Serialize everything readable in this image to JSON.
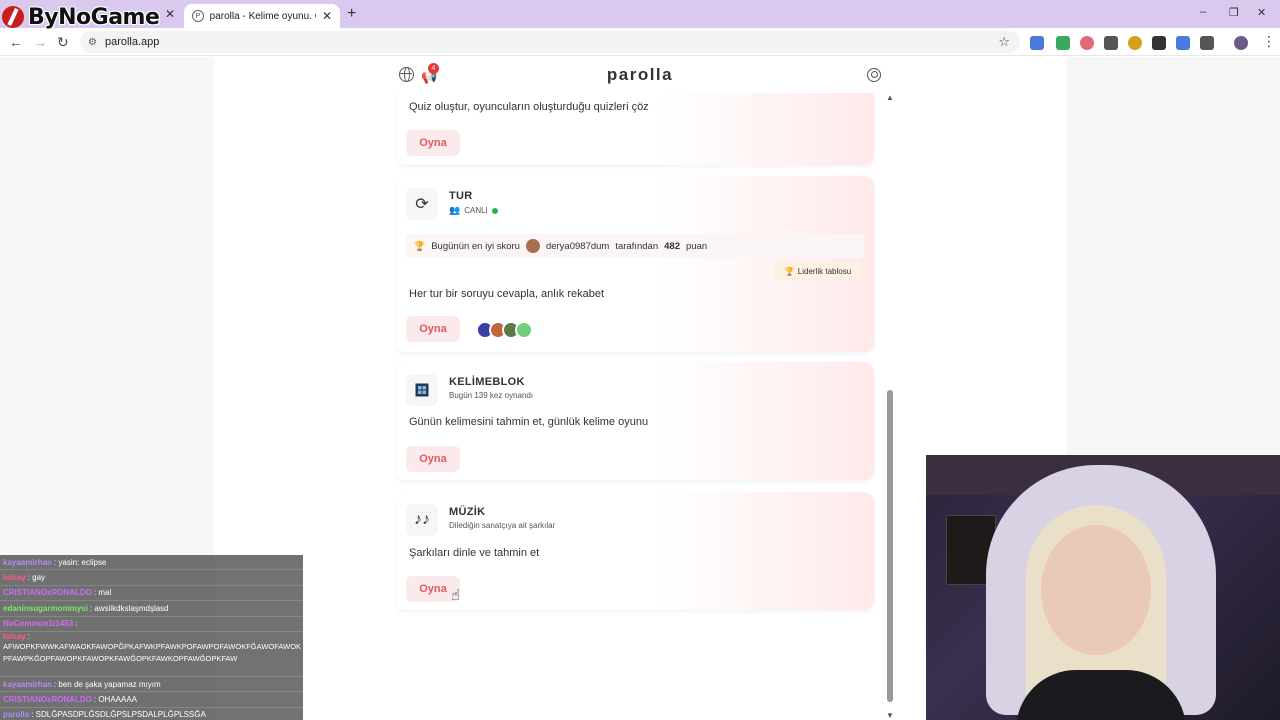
{
  "browser": {
    "brand_text": "ByNoGame",
    "active_tab_title": "parolla - Kelime oyunu. Günlük",
    "url": "parolla.app",
    "new_tab_symbol": "+",
    "window_controls": [
      "–",
      "❐",
      "✕"
    ]
  },
  "site": {
    "title": "parolla",
    "notification_count": "4"
  },
  "cards": {
    "quiz": {
      "description": "Quiz oluştur, oyuncuların oluşturduğu quizleri çöz",
      "play_label": "Oyna"
    },
    "tur": {
      "title": "TUR",
      "status": "CANLI",
      "best_prefix": "Bugünün en iyi skoru",
      "best_user": "derya0987dum",
      "best_middle": "tarafından",
      "best_score": "482",
      "best_unit": "puan",
      "leaderboard_label": "Liderlik tablosu",
      "description": "Her tur bir soruyu cevapla, anlık rekabet",
      "play_label": "Oyna"
    },
    "kelimeblok": {
      "title": "KELİMEBLOK",
      "subtitle": "Bugün 139 kez oynandı",
      "description": "Günün kelimesini tahmin et, günlük kelime oyunu",
      "play_label": "Oyna"
    },
    "muzik": {
      "title": "MÜZİK",
      "subtitle": "Dilediğin sanatçıya ait şarkılar",
      "description": "Şarkıları dinle ve tahmin et",
      "play_label": "Oyna"
    }
  },
  "chat": [
    {
      "user": "kayaamirhan",
      "message": ": yasin: eclipse",
      "color": "#b38cf0"
    },
    {
      "user": "lolcay",
      "message": ": gay",
      "color": "#ff5a8a"
    },
    {
      "user": "CRISTIANOxRONALDO",
      "message": ": mal",
      "color": "#c86cf5"
    },
    {
      "user": "edaninsugarmommysi",
      "message": ": awsiikdkslaşmdşlasd",
      "color": "#7fe36b"
    },
    {
      "user": "NoCommon1t1453",
      "message": ":",
      "color": "#d46cf0"
    },
    {
      "user": "lolcay",
      "message": ":",
      "color": "#ff5a8a"
    },
    {
      "user": "",
      "message": "AFWOPKFWWKAFWAOKFAWOPĞPKAFWKPFAWKPOFAWPOFAWOKFĞAWOFAWOKPFAWPKĞOPFAWOPKFAWOPKFAWĞOPKFAWKOPFAWĞOPKFAW",
      "color": "#ffffff"
    },
    {
      "user": "kayaamirhan",
      "message": ": ben de şaka yapamaz mıyım",
      "color": "#b38cf0"
    },
    {
      "user": "CRISTIANOxRONALDO",
      "message": ": OHAAAAA",
      "color": "#c86cf5"
    },
    {
      "user": "parolla",
      "message": ": SDLĞPASDPLĞSDLĞPSLPSDALPLĞPLSSĞA",
      "color": "#a98cf0"
    }
  ],
  "icons": {
    "refresh": "refresh-icon",
    "kelimeblok": "grid-icon",
    "muzik": "music-icon"
  },
  "colors": {
    "tabbar": "#d9c9ef",
    "play_text": "#e05a5a",
    "play_bg": "#fbeaec",
    "live": "#22b24c"
  }
}
